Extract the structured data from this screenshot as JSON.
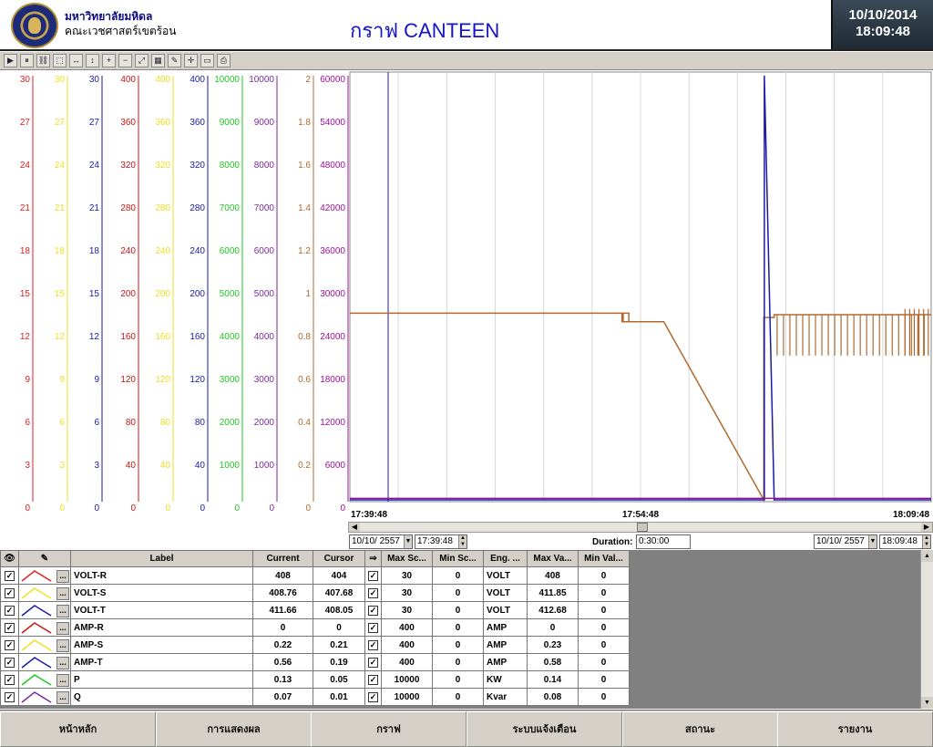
{
  "header": {
    "org_line1": "มหาวิทยาลัยมหิดล",
    "org_line2": "คณะเวชศาสตร์เขตร้อน",
    "title": "กราฟ CANTEEN",
    "date": "10/10/2014",
    "time": "18:09:48"
  },
  "toolbar_icons": [
    "play-icon",
    "pause-icon",
    "link-icon",
    "zoom-box-icon",
    "zoom-x-icon",
    "zoom-y-icon",
    "zoom-in-icon",
    "zoom-out-icon",
    "zoom-reset-icon",
    "grid-icon",
    "pen-icon",
    "crosshair-icon",
    "layout-icon",
    "print-icon"
  ],
  "chart_data": {
    "type": "line",
    "axes": [
      {
        "color": "#e02020",
        "ticks": [
          "30",
          "27",
          "24",
          "21",
          "18",
          "15",
          "12",
          "9",
          "6",
          "3",
          "0"
        ]
      },
      {
        "color": "#f0e020",
        "ticks": [
          "30",
          "27",
          "24",
          "21",
          "18",
          "15",
          "12",
          "9",
          "6",
          "3",
          "0"
        ]
      },
      {
        "color": "#1a1aa8",
        "ticks": [
          "30",
          "27",
          "24",
          "21",
          "18",
          "15",
          "12",
          "9",
          "6",
          "3",
          "0"
        ]
      },
      {
        "color": "#c81414",
        "ticks": [
          "400",
          "360",
          "320",
          "280",
          "240",
          "200",
          "160",
          "120",
          "80",
          "40",
          "0"
        ]
      },
      {
        "color": "#ece020",
        "ticks": [
          "400",
          "360",
          "320",
          "280",
          "240",
          "200",
          "160",
          "120",
          "80",
          "40",
          "0"
        ]
      },
      {
        "color": "#1a1aa8",
        "ticks": [
          "400",
          "360",
          "320",
          "280",
          "240",
          "200",
          "160",
          "120",
          "80",
          "40",
          "0"
        ]
      },
      {
        "color": "#22c822",
        "ticks": [
          "10000",
          "9000",
          "8000",
          "7000",
          "6000",
          "5000",
          "4000",
          "3000",
          "2000",
          "1000",
          "0"
        ]
      },
      {
        "color": "#7a2a9a",
        "ticks": [
          "10000",
          "9000",
          "8000",
          "7000",
          "6000",
          "5000",
          "4000",
          "3000",
          "2000",
          "1000",
          "0"
        ]
      },
      {
        "color": "#b06a30",
        "ticks": [
          "2",
          "1.8",
          "1.6",
          "1.4",
          "1.2",
          "1",
          "0.8",
          "0.6",
          "0.4",
          "0.2",
          "0"
        ]
      },
      {
        "color": "#a0109a",
        "ticks": [
          "60000",
          "54000",
          "48000",
          "42000",
          "36000",
          "30000",
          "24000",
          "18000",
          "12000",
          "6000",
          "0"
        ]
      }
    ],
    "x_start": "17:39:48",
    "x_mid": "17:54:48",
    "x_end": "18:09:48",
    "series": [
      {
        "color": "#b06a30",
        "x": [
          0,
          0.468,
          0.468,
          0.48,
          0.48,
          0.47,
          0.47,
          0.54,
          0.712,
          0.712,
          0.73,
          0.73,
          1.0
        ],
        "y": [
          26400,
          26400,
          25200,
          25200,
          26400,
          26400,
          25200,
          25200,
          0,
          25800,
          25800,
          26200,
          26200
        ]
      },
      {
        "color": "#1a1aa8",
        "x": [
          0,
          0.713,
          0.713,
          0.73,
          1.0
        ],
        "y": [
          0,
          0,
          60000,
          0,
          0
        ]
      },
      {
        "color": "#a0109a",
        "x": [
          0,
          1.0
        ],
        "y": [
          200,
          200
        ]
      }
    ]
  },
  "controls": {
    "start_date": "10/10/ 2557",
    "start_time": "17:39:48",
    "duration_label": "Duration:",
    "duration": "0:30:00",
    "end_date": "10/10/ 2557",
    "end_time": "18:09:48"
  },
  "table": {
    "headers": [
      "Label",
      "Current",
      "Cursor",
      "Max Sc...",
      "Min Sc...",
      "Eng. ...",
      "Max Va...",
      "Min Val..."
    ],
    "rows": [
      {
        "color": "#e02020",
        "label": "VOLT-R",
        "current": "408",
        "cursor": "404",
        "max_sc": "30",
        "min_sc": "0",
        "eng": "VOLT",
        "max_va": "408",
        "min_va": "0"
      },
      {
        "color": "#f0e020",
        "label": "VOLT-S",
        "current": "408.76",
        "cursor": "407.68",
        "max_sc": "30",
        "min_sc": "0",
        "eng": "VOLT",
        "max_va": "411.85",
        "min_va": "0"
      },
      {
        "color": "#1a1aa8",
        "label": "VOLT-T",
        "current": "411.66",
        "cursor": "408.05",
        "max_sc": "30",
        "min_sc": "0",
        "eng": "VOLT",
        "max_va": "412.68",
        "min_va": "0"
      },
      {
        "color": "#c81414",
        "label": "AMP-R",
        "current": "0",
        "cursor": "0",
        "max_sc": "400",
        "min_sc": "0",
        "eng": "AMP",
        "max_va": "0",
        "min_va": "0"
      },
      {
        "color": "#ece020",
        "label": "AMP-S",
        "current": "0.22",
        "cursor": "0.21",
        "max_sc": "400",
        "min_sc": "0",
        "eng": "AMP",
        "max_va": "0.23",
        "min_va": "0"
      },
      {
        "color": "#1a1aa8",
        "label": "AMP-T",
        "current": "0.56",
        "cursor": "0.19",
        "max_sc": "400",
        "min_sc": "0",
        "eng": "AMP",
        "max_va": "0.58",
        "min_va": "0"
      },
      {
        "color": "#22c822",
        "label": "P",
        "current": "0.13",
        "cursor": "0.05",
        "max_sc": "10000",
        "min_sc": "0",
        "eng": "KW",
        "max_va": "0.14",
        "min_va": "0"
      },
      {
        "color": "#7a2a9a",
        "label": "Q",
        "current": "0.07",
        "cursor": "0.01",
        "max_sc": "10000",
        "min_sc": "0",
        "eng": "Kvar",
        "max_va": "0.08",
        "min_va": "0"
      }
    ]
  },
  "nav": [
    "หน้าหลัก",
    "การแสดงผล",
    "กราฟ",
    "ระบบแจ้งเตือน",
    "สถานะ",
    "รายงาน"
  ]
}
